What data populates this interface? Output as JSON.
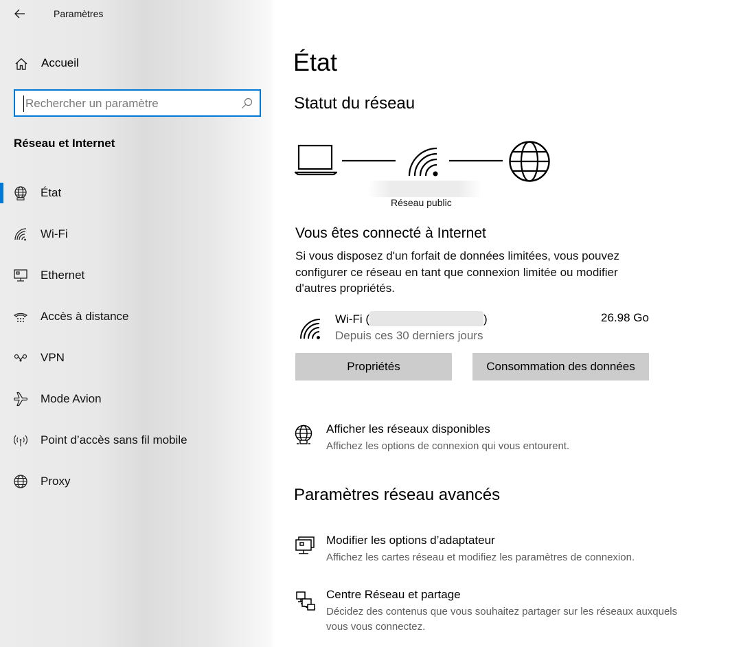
{
  "window": {
    "title": "Paramètres"
  },
  "sidebar": {
    "home_label": "Accueil",
    "search_placeholder": "Rechercher un paramètre",
    "section_title": "Réseau et Internet",
    "items": [
      {
        "label": "État",
        "icon": "globe-status-icon",
        "selected": true
      },
      {
        "label": "Wi-Fi",
        "icon": "wifi-icon",
        "selected": false
      },
      {
        "label": "Ethernet",
        "icon": "ethernet-icon",
        "selected": false
      },
      {
        "label": "Accès à distance",
        "icon": "dialup-icon",
        "selected": false
      },
      {
        "label": "VPN",
        "icon": "vpn-icon",
        "selected": false
      },
      {
        "label": "Mode Avion",
        "icon": "airplane-icon",
        "selected": false
      },
      {
        "label": "Point d’accès sans fil mobile",
        "icon": "hotspot-icon",
        "selected": false
      },
      {
        "label": "Proxy",
        "icon": "globe-icon",
        "selected": false
      }
    ]
  },
  "main": {
    "title": "État",
    "network_status_heading": "Statut du réseau",
    "diagram": {
      "network_label": "Réseau public"
    },
    "connection": {
      "title": "Vous êtes connecté à Internet",
      "description": "Si vous disposez d'un forfait de données limitées, vous pouvez configurer ce réseau en tant que connexion limitée ou modifier d'autres propriétés.",
      "adapter_prefix": "Wi-Fi (",
      "adapter_suffix": ")",
      "period": "Depuis ces 30 derniers jours",
      "usage": "26.98 Go"
    },
    "buttons": {
      "properties": "Propriétés",
      "data_usage": "Consommation des données"
    },
    "available_networks": {
      "title": "Afficher les réseaux disponibles",
      "desc": "Affichez les options de connexion qui vous entourent."
    },
    "advanced_heading": "Paramètres réseau avancés",
    "advanced": [
      {
        "title": "Modifier les options d’adaptateur",
        "desc": "Affichez les cartes réseau et modifiez les paramètres de connexion."
      },
      {
        "title": "Centre Réseau et partage",
        "desc": "Décidez des contenus que vous souhaitez partager sur les réseaux auxquels vous vous connectez."
      }
    ]
  },
  "colors": {
    "accent": "#0078d7",
    "button_bg": "#cccccc",
    "secondary_text": "#5d5d5d"
  }
}
